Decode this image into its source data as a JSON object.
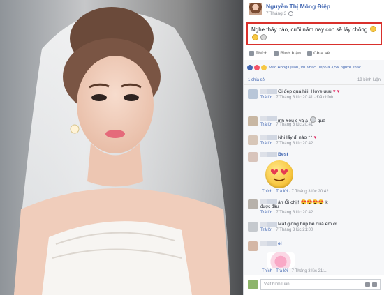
{
  "post": {
    "author": "Nguyễn Thị Mông Điệp",
    "time": "7 Tháng 3",
    "text": "Nghe thầy bảo, cuối năm nay con sẽ lấy chồng"
  },
  "actions": {
    "like": "Thích",
    "comment": "Bình luận",
    "share": "Chia sẻ"
  },
  "reactions": {
    "text": "Mac Hong Quan, Vu Khac Tiep và 3,5K người khác"
  },
  "shares": {
    "left": "1 chia sẻ",
    "right": "19 bình luận"
  },
  "comments": [
    {
      "text": "Ối đẹp quá hiii. I love uuu",
      "reply": "Trả lời",
      "time": "7 Tháng 3 lúc 20:41",
      "extra": "Đã chỉnh"
    },
    {
      "text": "inh Yêu c và a",
      "suffix": "quá",
      "reply": "Trả lời",
      "time": "7 Tháng 3 lúc 20:41"
    },
    {
      "text": "Nhi lấy đi nào ^^",
      "reply": "Trả lời",
      "time": "7 Tháng 3 lúc 20:42"
    },
    {
      "text": "Best"
    },
    {
      "reply": "Thích",
      "reply2": "Trả lời",
      "time": "7 Tháng 3 lúc 20:42"
    },
    {
      "text": "ân Ối chị!!",
      "suffix": "k",
      "text2": "được đâu",
      "reply": "Trả lời",
      "time": "7 Tháng 3 lúc 20:42"
    },
    {
      "text": "Mặt giống búp bê quá em ơi",
      "reply": "Trả lời",
      "time": "7 Tháng 3 lúc 21:00"
    },
    {
      "text": "el"
    },
    {
      "reply": "Thích",
      "reply2": "Trả lời",
      "time": "7 Tháng 3 lúc 21:..."
    }
  ],
  "composer": {
    "placeholder": "Viết bình luận..."
  },
  "colors": {
    "link": "#4267b2",
    "highlight_border": "#d9302c"
  }
}
